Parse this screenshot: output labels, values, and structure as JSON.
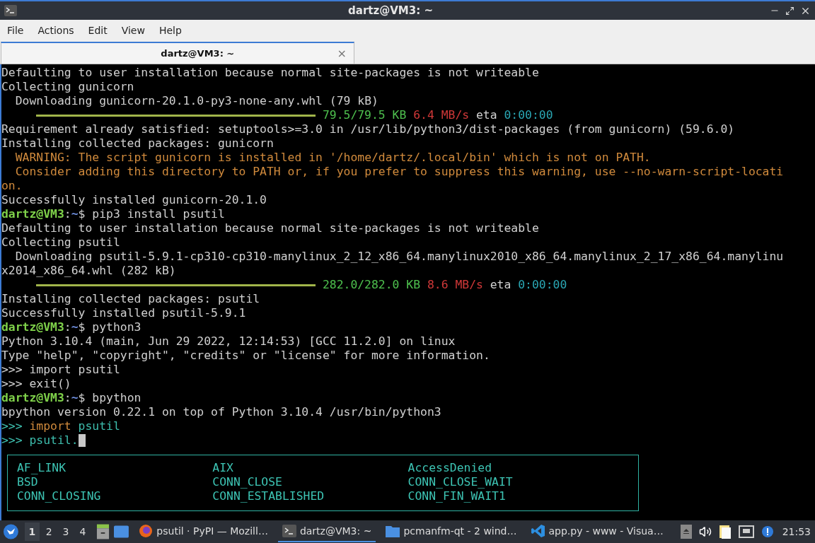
{
  "window": {
    "title": "dartz@VM3: ~"
  },
  "menu": [
    "File",
    "Actions",
    "Edit",
    "View",
    "Help"
  ],
  "tabs": [
    {
      "label": "dartz@VM3: ~",
      "selected": true,
      "close": "×"
    }
  ],
  "terminal": {
    "lines": [
      {
        "spans": [
          {
            "text": "Defaulting to user installation because normal site-packages is not writeable",
            "color": "#d0d0d0"
          }
        ]
      },
      {
        "spans": [
          {
            "text": "Collecting gunicorn",
            "color": "#d0d0d0"
          }
        ]
      },
      {
        "spans": [
          {
            "text": "  Downloading gunicorn-20.1.0-py3-none-any.whl (79 kB)",
            "color": "#d0d0d0"
          }
        ]
      },
      {
        "kind": "progress",
        "level": 1,
        "spans": [
          {
            "text": "79.5/79.5 KB",
            "color": "#4ec04e"
          },
          {
            "text": "6.4 MB/s",
            "color": "#d03838"
          },
          {
            "text": "eta",
            "color": "#d0d0d0"
          },
          {
            "text": "0:00:00",
            "color": "#2aa6b3"
          }
        ]
      },
      {
        "spans": [
          {
            "text": "Requirement already satisfied: setuptools>=3.0 in /usr/lib/python3/dist-packages (from gunicorn) (59.6.0)",
            "color": "#d0d0d0"
          }
        ]
      },
      {
        "spans": [
          {
            "text": "Installing collected packages: gunicorn",
            "color": "#d0d0d0"
          }
        ]
      },
      {
        "spans": [
          {
            "text": "  WARNING: The script gunicorn is installed in '/home/dartz/.local/bin' which is not on PATH.",
            "color": "#d08a3c"
          }
        ]
      },
      {
        "spans": [
          {
            "text": "  Consider adding this directory to PATH or, if you prefer to suppress this warning, use --no-warn-script-locati",
            "color": "#d08a3c"
          }
        ]
      },
      {
        "spans": [
          {
            "text": "on.",
            "color": "#d08a3c"
          }
        ]
      },
      {
        "spans": [
          {
            "text": "Successfully installed gunicorn-20.1.0",
            "color": "#d0d0d0"
          }
        ]
      },
      {
        "spans": [
          {
            "text": "dartz@VM3",
            "color": "#7fd14a",
            "bold": true
          },
          {
            "text": ":",
            "color": "#d0d0d0"
          },
          {
            "text": "~",
            "color": "#6f8fe0",
            "bold": true
          },
          {
            "text": "$ pip3 install psutil",
            "color": "#d0d0d0"
          }
        ]
      },
      {
        "spans": [
          {
            "text": "Defaulting to user installation because normal site-packages is not writeable",
            "color": "#d0d0d0"
          }
        ]
      },
      {
        "spans": [
          {
            "text": "Collecting psutil",
            "color": "#d0d0d0"
          }
        ]
      },
      {
        "spans": [
          {
            "text": "  Downloading psutil-5.9.1-cp310-cp310-manylinux_2_12_x86_64.manylinux2010_x86_64.manylinux_2_17_x86_64.manylinu",
            "color": "#d0d0d0"
          }
        ]
      },
      {
        "spans": [
          {
            "text": "x2014_x86_64.whl (282 kB)",
            "color": "#d0d0d0"
          }
        ]
      },
      {
        "kind": "progress",
        "level": 1,
        "spans": [
          {
            "text": "282.0/282.0 KB",
            "color": "#4ec04e"
          },
          {
            "text": "8.6 MB/s",
            "color": "#d03838"
          },
          {
            "text": "eta",
            "color": "#d0d0d0"
          },
          {
            "text": "0:00:00",
            "color": "#2aa6b3"
          }
        ]
      },
      {
        "spans": [
          {
            "text": "Installing collected packages: psutil",
            "color": "#d0d0d0"
          }
        ]
      },
      {
        "spans": [
          {
            "text": "Successfully installed psutil-5.9.1",
            "color": "#d0d0d0"
          }
        ]
      },
      {
        "spans": [
          {
            "text": "dartz@VM3",
            "color": "#7fd14a",
            "bold": true
          },
          {
            "text": ":",
            "color": "#d0d0d0"
          },
          {
            "text": "~",
            "color": "#6f8fe0",
            "bold": true
          },
          {
            "text": "$ python3",
            "color": "#d0d0d0"
          }
        ]
      },
      {
        "spans": [
          {
            "text": "Python 3.10.4 (main, Jun 29 2022, 12:14:53) [GCC 11.2.0] on linux",
            "color": "#d0d0d0"
          }
        ]
      },
      {
        "spans": [
          {
            "text": "Type \"help\", \"copyright\", \"credits\" or \"license\" for more information.",
            "color": "#d0d0d0"
          }
        ]
      },
      {
        "spans": [
          {
            "text": ">>> import psutil",
            "color": "#d0d0d0"
          }
        ]
      },
      {
        "spans": [
          {
            "text": ">>> exit()",
            "color": "#d0d0d0"
          }
        ]
      },
      {
        "spans": [
          {
            "text": "dartz@VM3",
            "color": "#7fd14a",
            "bold": true
          },
          {
            "text": ":",
            "color": "#d0d0d0"
          },
          {
            "text": "~",
            "color": "#6f8fe0",
            "bold": true
          },
          {
            "text": "$ bpython",
            "color": "#d0d0d0"
          }
        ]
      },
      {
        "spans": [
          {
            "text": "bpython version 0.22.1 on top of Python 3.10.4 /usr/bin/python3",
            "color": "#d0d0d0"
          }
        ]
      },
      {
        "spans": [
          {
            "text": ">>>",
            "color": "#3dbdad"
          },
          {
            "text": " import",
            "color": "#d08a3c"
          },
          {
            "text": " psutil",
            "color": "#3dbdad"
          }
        ]
      },
      {
        "cursor": true,
        "spans": [
          {
            "text": ">>>",
            "color": "#3dbdad"
          },
          {
            "text": " psutil.",
            "color": "#3dbdad"
          }
        ]
      }
    ],
    "completions": [
      [
        "AF_LINK",
        "AIX",
        "AccessDenied"
      ],
      [
        "BSD",
        "CONN_CLOSE",
        "CONN_CLOSE_WAIT"
      ],
      [
        "CONN_CLOSING",
        "CONN_ESTABLISHED",
        "CONN_FIN_WAIT1"
      ]
    ]
  },
  "taskbar": {
    "desktops": [
      {
        "label": "1",
        "selected": true
      },
      {
        "label": "2",
        "selected": false
      },
      {
        "label": "3",
        "selected": false
      },
      {
        "label": "4",
        "selected": false
      }
    ],
    "tasks": [
      {
        "kind": "firefox",
        "label": "psutil · PyPI — Mozill…",
        "selected": false
      },
      {
        "kind": "terminal",
        "label": "dartz@VM3: ~",
        "selected": true
      },
      {
        "kind": "folder",
        "label": "pcmanfm-qt - 2 wind…",
        "selected": false
      },
      {
        "kind": "vscode",
        "label": "app.py - www - Visua…",
        "selected": false
      }
    ],
    "clock": "21:53"
  }
}
